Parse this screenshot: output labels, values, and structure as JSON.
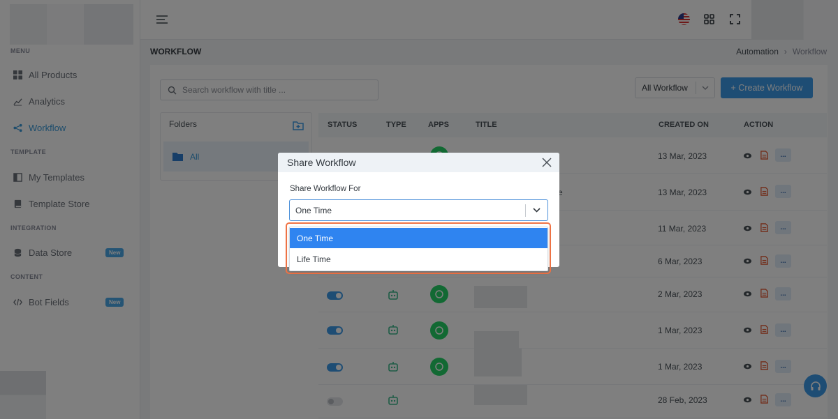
{
  "sidebar": {
    "sections": [
      {
        "title": "MENU"
      },
      {
        "title": "TEMPLATE"
      },
      {
        "title": "INTEGRATION"
      },
      {
        "title": "CONTENT"
      }
    ],
    "items": [
      {
        "label": "All Products",
        "icon": "grid-icon"
      },
      {
        "label": "Analytics",
        "icon": "chart-line-icon"
      },
      {
        "label": "Workflow",
        "icon": "share-nodes-icon",
        "active": true
      },
      {
        "label": "My Templates",
        "icon": "layout-icon"
      },
      {
        "label": "Template Store",
        "icon": "book-icon"
      },
      {
        "label": "Data Store",
        "icon": "database-icon",
        "badge": "New"
      },
      {
        "label": "Bot Fields",
        "icon": "code-icon",
        "badge": "New"
      }
    ]
  },
  "header": {
    "page_title": "WORKFLOW",
    "breadcrumb": [
      "Automation",
      "Workflow"
    ]
  },
  "toolbar": {
    "search_placeholder": "Search workflow with title ...",
    "filter_value": "All Workflow",
    "create_label": "+ Create Workflow"
  },
  "folders": {
    "heading": "Folders",
    "items": [
      {
        "label": "All"
      }
    ]
  },
  "table": {
    "columns": [
      "STATUS",
      "TYPE",
      "APPS",
      "TITLE",
      "CREATED ON",
      "ACTION"
    ],
    "rows": [
      {
        "created_on": "13 Mar, 2023",
        "status": "on"
      },
      {
        "created_on": "13 Mar, 2023",
        "status": "on",
        "title_fragment": "e"
      },
      {
        "created_on": "11 Mar, 2023",
        "status": "on"
      },
      {
        "created_on": "6 Mar, 2023",
        "status": "on"
      },
      {
        "created_on": "2 Mar, 2023",
        "status": "on"
      },
      {
        "created_on": "1 Mar, 2023",
        "status": "on"
      },
      {
        "created_on": "1 Mar, 2023",
        "status": "on"
      },
      {
        "created_on": "28 Feb, 2023",
        "status": "off"
      }
    ],
    "more_label": "..."
  },
  "modal": {
    "title": "Share Workflow",
    "field_label": "Share Workflow For",
    "selected_value": "One Time",
    "options": [
      "One Time",
      "Life Time"
    ]
  },
  "colors": {
    "accent": "#3d9ae8",
    "highlight": "#f07345",
    "whatsapp": "#25d366",
    "bot": "#3ab88b"
  }
}
